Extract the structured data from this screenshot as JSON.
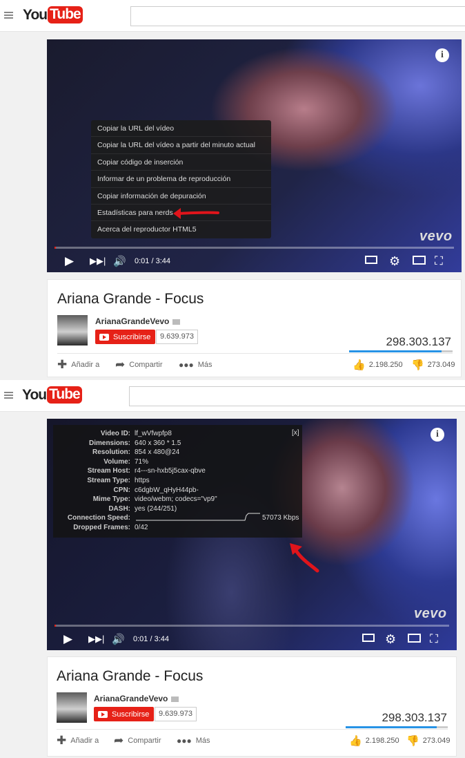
{
  "logo": {
    "you": "You",
    "tube": "Tube"
  },
  "video": {
    "time_current": "0:01",
    "time_sep": " / ",
    "time_total": "3:44",
    "watermark": "vevo",
    "progress_fraction": 0.003
  },
  "context_menu": {
    "items": [
      "Copiar la URL del vídeo",
      "Copiar la URL del vídeo a partir del minuto actual",
      "Copiar código de inserción",
      "Informar de un problema de reproducción",
      "Copiar información de depuración",
      "Estadísticas para nerds",
      "Acerca del reproductor HTML5"
    ]
  },
  "stats_for_nerds": {
    "close": "[x]",
    "rows": [
      {
        "label": "Video ID:",
        "value": "lf_wVfwpfp8"
      },
      {
        "label": "Dimensions:",
        "value": "640 x 360 * 1.5"
      },
      {
        "label": "Resolution:",
        "value": "854 x 480@24"
      },
      {
        "label": "Volume:",
        "value": "71%"
      },
      {
        "label": "Stream Host:",
        "value": "r4---sn-hxb5j5cax-qbve"
      },
      {
        "label": "Stream Type:",
        "value": "https"
      },
      {
        "label": "CPN:",
        "value": "c6dgbW_qHyH44pb-"
      },
      {
        "label": "Mime Type:",
        "value": "video/webm; codecs=\"vp9\""
      },
      {
        "label": "DASH:",
        "value": "yes (244/251)"
      },
      {
        "label": "Connection Speed:",
        "value": "57073 Kbps"
      },
      {
        "label": "Dropped Frames:",
        "value": "0/42"
      }
    ]
  },
  "watch": {
    "title": "Ariana Grande - Focus",
    "channel": "ArianaGrandeVevo",
    "subscribe_label": "Suscribirse",
    "subscriber_count": "9.639.973",
    "views": "298.303.137",
    "like_ratio": 0.89,
    "add_to": "Añadir a",
    "share": "Compartir",
    "more": "Más",
    "likes": "2.198.250",
    "dislikes": "273.049"
  },
  "colors": {
    "brand_red": "#e62117",
    "annotation_red": "#e0141b",
    "views_bar_blue": "#2793e6"
  }
}
